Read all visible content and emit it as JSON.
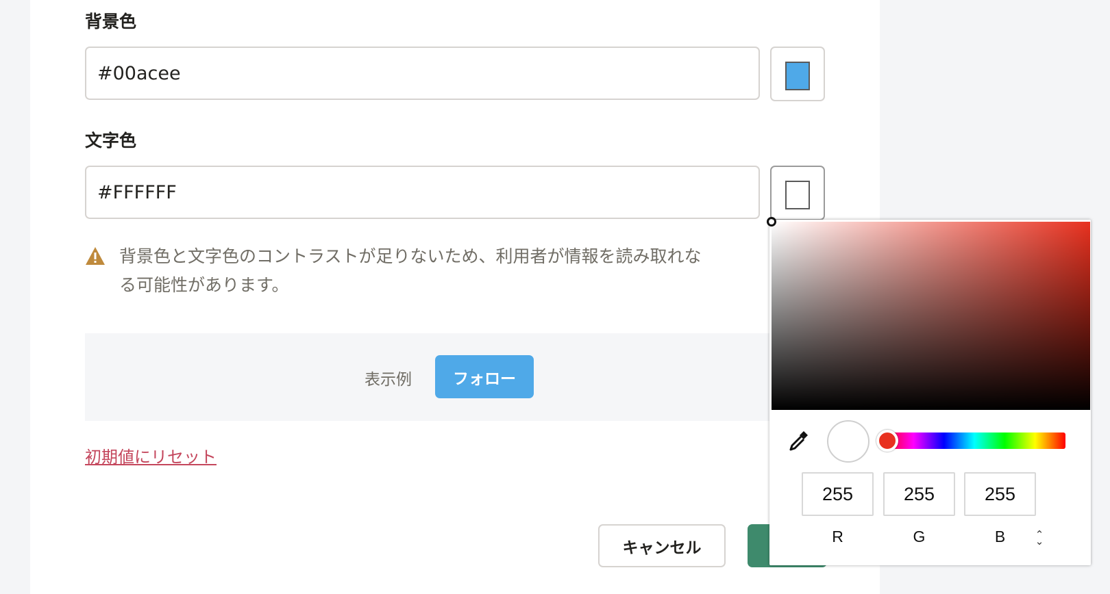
{
  "form": {
    "background_label": "背景色",
    "background_value": "#00acee",
    "background_swatch_color": "#4fa9e8",
    "text_label": "文字色",
    "text_value": "#FFFFFF",
    "text_swatch_color": "#ffffff",
    "warning_text": "背景色と文字色のコントラストが足りないため、利用者が情報を読み取れな\nる可能性があります。",
    "warning_icon_color": "#bf8a3c",
    "preview_label": "表示例",
    "preview_button_label": "フォロー",
    "preview_button_bg": "#4fa9e8",
    "reset_link": "初期値にリセット",
    "cancel_label": "キャンセル",
    "save_label": ""
  },
  "picker": {
    "hue_color": "#e8311f",
    "preview_color": "#ffffff",
    "r": "255",
    "g": "255",
    "b": "255",
    "r_label": "R",
    "g_label": "G",
    "b_label": "B",
    "mode_toggle_icon": "up-down-chevron-icon",
    "eyedropper_icon": "eyedropper-icon"
  }
}
